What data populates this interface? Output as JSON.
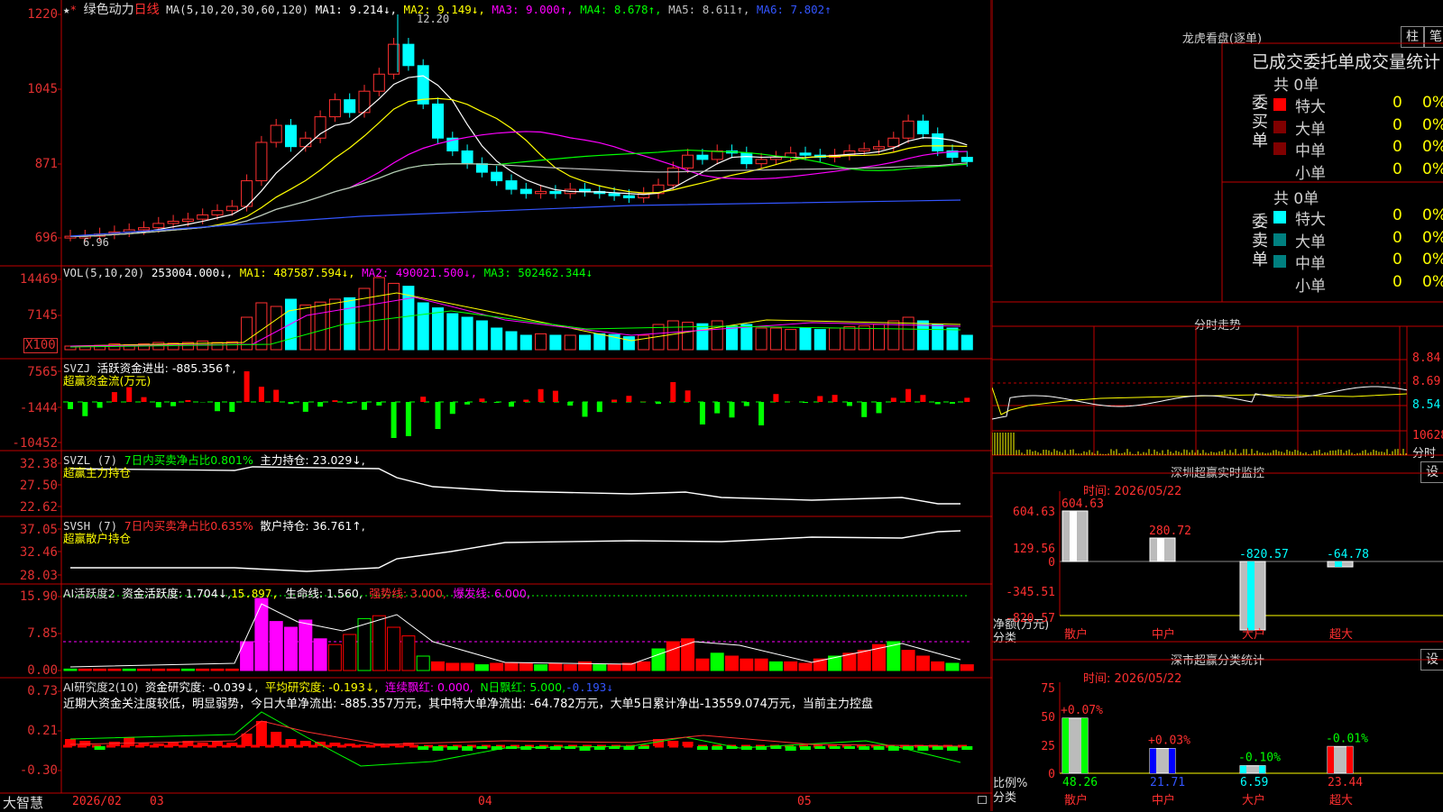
{
  "stock": {
    "star": "★",
    "mark": "*",
    "name": "绿色动力",
    "period": "日线"
  },
  "ma": {
    "label": "MA(5,10,20,30,60,120)",
    "ma1": "MA1: 9.214↓,",
    "ma2": "MA2: 9.149↓,",
    "ma3": "MA3: 9.000↑,",
    "ma4": "MA4: 8.678↑,",
    "ma5": "MA5: 8.611↑,",
    "ma6": "MA6: 7.802↑",
    "high_label": "12.20",
    "low_label": "6.96"
  },
  "price_axis": [
    "1220",
    "1045",
    "871",
    "696"
  ],
  "vol": {
    "label": "VOL(5,10,20)",
    "value": "253004.000↓,",
    "ma1": "MA1: 487587.594↓,",
    "ma2": "MA2: 490021.500↓,",
    "ma3": "MA3: 502462.344↓",
    "axis": [
      "14469",
      "7145"
    ],
    "unit": "X100"
  },
  "svzj": {
    "label": "SVZJ",
    "text": "活跃资金进出: -885.356↑,",
    "sub": "超赢资金流(万元)",
    "axis": [
      "7565",
      "-1444",
      "-10452"
    ]
  },
  "svzl": {
    "label": "SVZL (7)",
    "pct": "7日内买卖净占比0.801%",
    "hold": "主力持仓: 23.029↓,",
    "sub": "超赢主力持仓",
    "axis": [
      "32.38",
      "27.50",
      "22.62"
    ]
  },
  "svsh": {
    "label": "SVSH (7)",
    "pct": "7日内买卖净占比0.635%",
    "hold": "散户持仓: 36.761↑,",
    "sub": "超赢散户持仓",
    "axis": [
      "37.05",
      "32.46",
      "28.03"
    ]
  },
  "ai2": {
    "label": "AI活跃度2",
    "val1": "资金活跃度: 1.704↓,",
    "val2": "15.897,",
    "val3": "生命线: 1.560,",
    "val4": "强势线: 3.000,",
    "val5": "爆发线: 6.000,",
    "axis": [
      "15.90",
      "7.85",
      "0.00"
    ]
  },
  "ai_res": {
    "label": "AI研究度2(10)",
    "val1": "资金研究度: -0.039↓,",
    "val2": "平均研究度: -0.193↓,",
    "val3": "连续飘红: 0.000,",
    "val4": "N日飘红: 5.000,",
    "val5": "-0.193↓",
    "text": "近期大资金关注度较低，明显弱势，今日大单净流出: -885.357万元，其中特大单净流出: -64.782万元，大单5日累计净出-13559.074万元，当前主力控盘",
    "axis": [
      "0.73",
      "0.21",
      "-0.30"
    ]
  },
  "bottom": {
    "logo": "大智慧",
    "dates": [
      "2026/02",
      "03",
      "04",
      "05"
    ]
  },
  "dragon": {
    "title": "龙虎看盘(逐单)",
    "btn1": "柱",
    "btn2": "笔",
    "header": "已成交委托单成交量统计",
    "buy": {
      "side": "委买单",
      "total": "共 0单",
      "rows": [
        {
          "label": "特大",
          "n": "0",
          "p": "0%",
          "color": "#ff0000"
        },
        {
          "label": "大单",
          "n": "0",
          "p": "0%",
          "color": "#800000"
        },
        {
          "label": "中单",
          "n": "0",
          "p": "0%",
          "color": "#800000"
        },
        {
          "label": "小单",
          "n": "0",
          "p": "0%",
          "color": ""
        }
      ]
    },
    "sell": {
      "side": "委卖单",
      "total": "共 0单",
      "rows": [
        {
          "label": "特大",
          "n": "0",
          "p": "0%",
          "color": "#00ffff"
        },
        {
          "label": "大单",
          "n": "0",
          "p": "0%",
          "color": "#008080"
        },
        {
          "label": "中单",
          "n": "0",
          "p": "0%",
          "color": "#008080"
        },
        {
          "label": "小单",
          "n": "0",
          "p": "0%",
          "color": ""
        }
      ]
    }
  },
  "intraday": {
    "title": "分时走势",
    "prices": [
      "8.84",
      "8.69",
      "8.54"
    ],
    "vol": "10628",
    "vol_unit": "分时"
  },
  "sz_monitor": {
    "title": "深圳超赢实时监控",
    "btn": "设",
    "time": "时间: 2026/05/22",
    "axis": [
      "604.63",
      "129.56",
      "0",
      "-345.51",
      "-820.57"
    ],
    "yname": "净额(万元)",
    "xname": "分类",
    "cats": [
      "散户",
      "中户",
      "大户",
      "超大"
    ],
    "values": [
      604.63,
      280.72,
      -820.57,
      -64.78
    ],
    "labels": [
      "604.63",
      "280.72",
      "-820.57",
      "-64.78"
    ]
  },
  "sz_stats": {
    "title": "深市超赢分类统计",
    "btn": "设",
    "time": "时间: 2026/05/22",
    "axis": [
      "75",
      "50",
      "25",
      "0"
    ],
    "yname": "比例%",
    "xname": "分类",
    "cats": [
      "散户",
      "中户",
      "大户",
      "超大"
    ],
    "values": [
      48.26,
      21.71,
      6.59,
      23.44
    ],
    "changes": [
      "+0.07%",
      "+0.03%",
      "-0.10%",
      "-0.01%"
    ],
    "labels": [
      "48.26",
      "21.71",
      "6.59",
      "23.44"
    ]
  }
}
